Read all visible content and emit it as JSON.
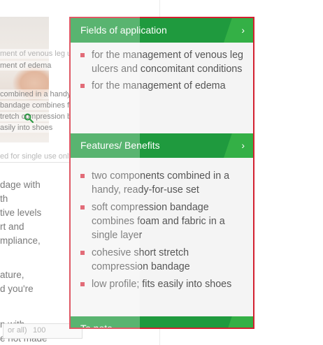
{
  "background": {
    "captions": [
      "ment of venous leg ulcers and concomi",
      "ment of edema",
      "combined in a handy, ready-for-use s",
      "bandage combines foam and fabric in",
      "tretch compression bandage",
      "asily into shoes"
    ],
    "hint": "ed for single use only therapeutic worki",
    "body_lines": [
      "dage with",
      "th",
      "tive levels",
      "rt and",
      "mpliance,",
      "",
      "ature,",
      "d you're",
      "",
      "n with",
      "e not made"
    ],
    "qty_label": "or all)",
    "qty_value": "100"
  },
  "accordion": {
    "sections": [
      {
        "title": "Fields of application",
        "chevron": "›",
        "items": [
          "for the management of venous leg ulcers and concomitant conditions",
          "for the management of edema"
        ]
      },
      {
        "title": "Features/ Benefits",
        "chevron": "›",
        "items": [
          "two components combined in a handy, ready-for-use set",
          "soft compression bandage combines foam and fabric in a single layer",
          "cohesive short stretch compression bandage",
          "low profile; fits easily into shoes"
        ]
      },
      {
        "title": "To note",
        "chevron": "⌄",
        "items": []
      }
    ]
  },
  "colors": {
    "header_green": "#1f9a3e",
    "header_accent": "#34b046",
    "bullet_red": "#d8394a",
    "panel_border": "#d32030"
  },
  "icons": {
    "zoom": "magnifier-icon",
    "expand": "chevron-right-icon",
    "collapse": "chevron-down-icon"
  }
}
